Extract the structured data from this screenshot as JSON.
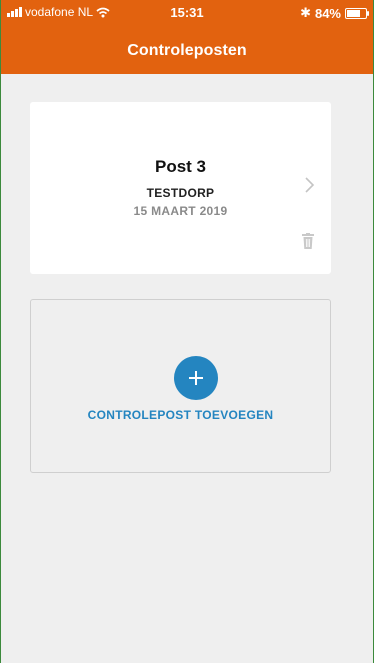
{
  "status_bar": {
    "carrier": "vodafone NL",
    "time": "15:31",
    "bluetooth_symbol": "✱",
    "battery": "84%",
    "battery_level": 0.84
  },
  "nav": {
    "title": "Controleposten"
  },
  "posts": [
    {
      "title": "Post 3",
      "place": "TESTDORP",
      "date": "15 MAART 2019"
    }
  ],
  "add_post": {
    "label": "CONTROLEPOST TOEVOEGEN"
  },
  "colors": {
    "header": "#e2620f",
    "accent": "#2485c0",
    "background": "#efefef"
  }
}
